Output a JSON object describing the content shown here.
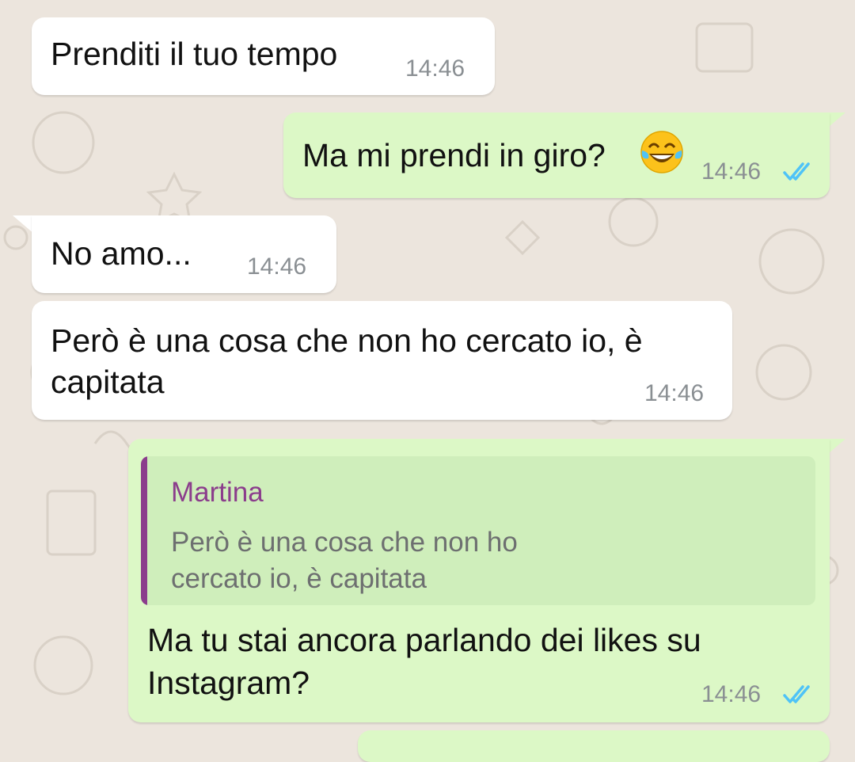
{
  "messages": [
    {
      "direction": "incoming",
      "text": "Prenditi il tuo tempo",
      "time": "14:46"
    },
    {
      "direction": "outgoing",
      "text": "Ma mi prendi in giro?",
      "emoji": "face-with-tears-of-joy",
      "time": "14:46",
      "status": "read"
    },
    {
      "direction": "incoming",
      "text": "No amo...",
      "time": "14:46"
    },
    {
      "direction": "incoming",
      "text_line1": "Però è una cosa che non ho cercato io, è",
      "text_line2": "capitata",
      "time": "14:46"
    },
    {
      "direction": "outgoing",
      "quote": {
        "author": "Martina",
        "line1": "Però è una cosa che non ho",
        "line2": "cercato io, è capitata"
      },
      "text_line1": "Ma tu stai ancora parlando dei likes su",
      "text_line2": "Instagram?",
      "time": "14:46",
      "status": "read"
    }
  ],
  "colors": {
    "background": "#ece5dd",
    "incoming_bubble": "#ffffff",
    "outgoing_bubble": "#dcf8c6",
    "read_ticks": "#4fc3f7",
    "quote_author": "#8b3d8c"
  }
}
